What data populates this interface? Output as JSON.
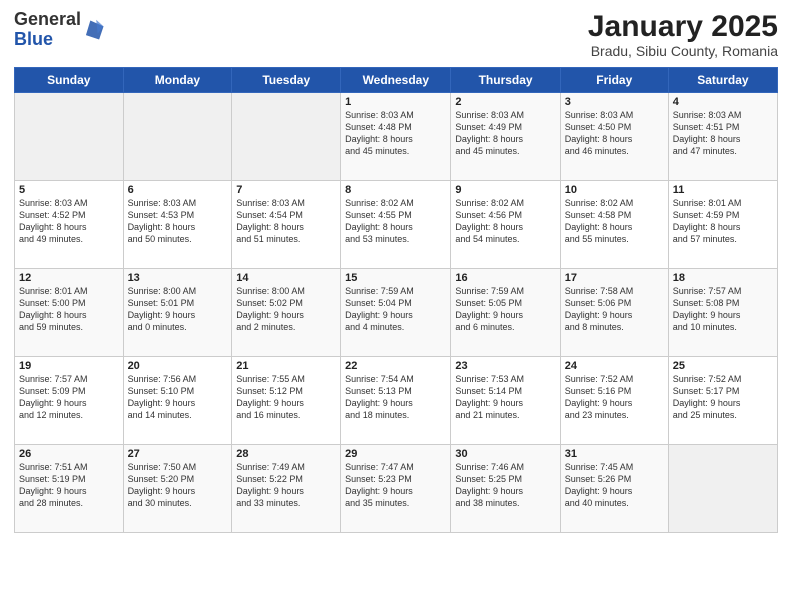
{
  "header": {
    "logo_general": "General",
    "logo_blue": "Blue",
    "main_title": "January 2025",
    "subtitle": "Bradu, Sibiu County, Romania"
  },
  "days_of_week": [
    "Sunday",
    "Monday",
    "Tuesday",
    "Wednesday",
    "Thursday",
    "Friday",
    "Saturday"
  ],
  "weeks": [
    [
      {
        "day": "",
        "content": ""
      },
      {
        "day": "",
        "content": ""
      },
      {
        "day": "",
        "content": ""
      },
      {
        "day": "1",
        "content": "Sunrise: 8:03 AM\nSunset: 4:48 PM\nDaylight: 8 hours\nand 45 minutes."
      },
      {
        "day": "2",
        "content": "Sunrise: 8:03 AM\nSunset: 4:49 PM\nDaylight: 8 hours\nand 45 minutes."
      },
      {
        "day": "3",
        "content": "Sunrise: 8:03 AM\nSunset: 4:50 PM\nDaylight: 8 hours\nand 46 minutes."
      },
      {
        "day": "4",
        "content": "Sunrise: 8:03 AM\nSunset: 4:51 PM\nDaylight: 8 hours\nand 47 minutes."
      }
    ],
    [
      {
        "day": "5",
        "content": "Sunrise: 8:03 AM\nSunset: 4:52 PM\nDaylight: 8 hours\nand 49 minutes."
      },
      {
        "day": "6",
        "content": "Sunrise: 8:03 AM\nSunset: 4:53 PM\nDaylight: 8 hours\nand 50 minutes."
      },
      {
        "day": "7",
        "content": "Sunrise: 8:03 AM\nSunset: 4:54 PM\nDaylight: 8 hours\nand 51 minutes."
      },
      {
        "day": "8",
        "content": "Sunrise: 8:02 AM\nSunset: 4:55 PM\nDaylight: 8 hours\nand 53 minutes."
      },
      {
        "day": "9",
        "content": "Sunrise: 8:02 AM\nSunset: 4:56 PM\nDaylight: 8 hours\nand 54 minutes."
      },
      {
        "day": "10",
        "content": "Sunrise: 8:02 AM\nSunset: 4:58 PM\nDaylight: 8 hours\nand 55 minutes."
      },
      {
        "day": "11",
        "content": "Sunrise: 8:01 AM\nSunset: 4:59 PM\nDaylight: 8 hours\nand 57 minutes."
      }
    ],
    [
      {
        "day": "12",
        "content": "Sunrise: 8:01 AM\nSunset: 5:00 PM\nDaylight: 8 hours\nand 59 minutes."
      },
      {
        "day": "13",
        "content": "Sunrise: 8:00 AM\nSunset: 5:01 PM\nDaylight: 9 hours\nand 0 minutes."
      },
      {
        "day": "14",
        "content": "Sunrise: 8:00 AM\nSunset: 5:02 PM\nDaylight: 9 hours\nand 2 minutes."
      },
      {
        "day": "15",
        "content": "Sunrise: 7:59 AM\nSunset: 5:04 PM\nDaylight: 9 hours\nand 4 minutes."
      },
      {
        "day": "16",
        "content": "Sunrise: 7:59 AM\nSunset: 5:05 PM\nDaylight: 9 hours\nand 6 minutes."
      },
      {
        "day": "17",
        "content": "Sunrise: 7:58 AM\nSunset: 5:06 PM\nDaylight: 9 hours\nand 8 minutes."
      },
      {
        "day": "18",
        "content": "Sunrise: 7:57 AM\nSunset: 5:08 PM\nDaylight: 9 hours\nand 10 minutes."
      }
    ],
    [
      {
        "day": "19",
        "content": "Sunrise: 7:57 AM\nSunset: 5:09 PM\nDaylight: 9 hours\nand 12 minutes."
      },
      {
        "day": "20",
        "content": "Sunrise: 7:56 AM\nSunset: 5:10 PM\nDaylight: 9 hours\nand 14 minutes."
      },
      {
        "day": "21",
        "content": "Sunrise: 7:55 AM\nSunset: 5:12 PM\nDaylight: 9 hours\nand 16 minutes."
      },
      {
        "day": "22",
        "content": "Sunrise: 7:54 AM\nSunset: 5:13 PM\nDaylight: 9 hours\nand 18 minutes."
      },
      {
        "day": "23",
        "content": "Sunrise: 7:53 AM\nSunset: 5:14 PM\nDaylight: 9 hours\nand 21 minutes."
      },
      {
        "day": "24",
        "content": "Sunrise: 7:52 AM\nSunset: 5:16 PM\nDaylight: 9 hours\nand 23 minutes."
      },
      {
        "day": "25",
        "content": "Sunrise: 7:52 AM\nSunset: 5:17 PM\nDaylight: 9 hours\nand 25 minutes."
      }
    ],
    [
      {
        "day": "26",
        "content": "Sunrise: 7:51 AM\nSunset: 5:19 PM\nDaylight: 9 hours\nand 28 minutes."
      },
      {
        "day": "27",
        "content": "Sunrise: 7:50 AM\nSunset: 5:20 PM\nDaylight: 9 hours\nand 30 minutes."
      },
      {
        "day": "28",
        "content": "Sunrise: 7:49 AM\nSunset: 5:22 PM\nDaylight: 9 hours\nand 33 minutes."
      },
      {
        "day": "29",
        "content": "Sunrise: 7:47 AM\nSunset: 5:23 PM\nDaylight: 9 hours\nand 35 minutes."
      },
      {
        "day": "30",
        "content": "Sunrise: 7:46 AM\nSunset: 5:25 PM\nDaylight: 9 hours\nand 38 minutes."
      },
      {
        "day": "31",
        "content": "Sunrise: 7:45 AM\nSunset: 5:26 PM\nDaylight: 9 hours\nand 40 minutes."
      },
      {
        "day": "",
        "content": ""
      }
    ]
  ]
}
